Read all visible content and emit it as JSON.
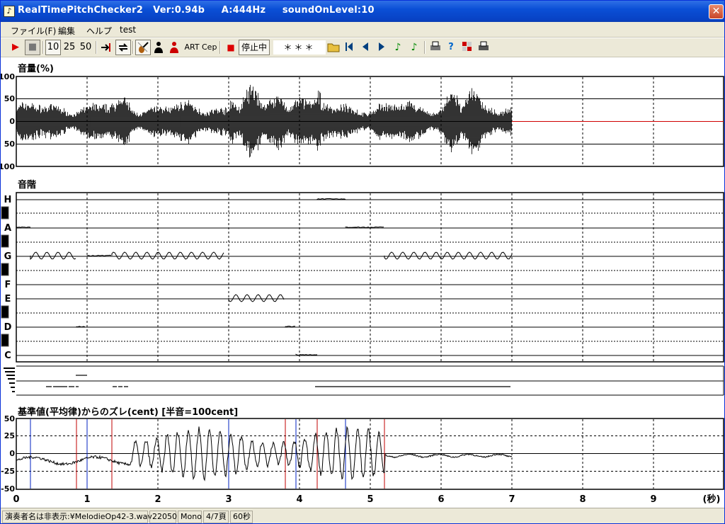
{
  "window": {
    "title": "RealTimePitchChecker2   Ver:0.94b     A:444Hz     soundOnLevel:10",
    "app_icon": "clef-icon",
    "close_glyph": "✕"
  },
  "menu": [
    "ファイル(F)",
    "編集",
    "ヘルプ",
    "test"
  ],
  "toolbar": {
    "play": "▶",
    "stop": "■",
    "speed_10": "10",
    "speed_25": "25",
    "speed_50": "50",
    "art": "ART",
    "cep": "Cep",
    "status_label": "停止中",
    "note_display": "＊＊＊"
  },
  "volume_panel": {
    "title": "音量(%)",
    "y_ticks": [
      "100",
      "50",
      "0",
      "50",
      "100"
    ]
  },
  "scale_panel": {
    "title": "音階",
    "notes": [
      "H",
      "A",
      "G",
      "F",
      "E",
      "D",
      "C"
    ]
  },
  "cent_panel": {
    "title": "基準値(平均律)からのズレ(cent) [半音=100cent]",
    "y_ticks": [
      "50",
      "25",
      "0",
      "-25",
      "-50"
    ]
  },
  "time_axis": {
    "ticks": [
      "0",
      "1",
      "2",
      "3",
      "4",
      "5",
      "6",
      "7",
      "8",
      "9"
    ],
    "unit": "(秒)"
  },
  "chart_data": {
    "type": "line",
    "x_range": [
      0,
      10
    ],
    "x_unit": "seconds",
    "recorded_until": 7,
    "volume": {
      "ylim": [
        -100,
        100
      ]
    },
    "pitch_segments": [
      {
        "note": "A",
        "start": 0.0,
        "end": 0.2
      },
      {
        "note": "G",
        "start": 0.2,
        "end": 0.85
      },
      {
        "note": "D",
        "start": 0.85,
        "end": 0.98
      },
      {
        "note": "G",
        "start": 1.0,
        "end": 1.35
      },
      {
        "note": "G",
        "start": 1.35,
        "end": 2.95
      },
      {
        "note": "E",
        "start": 3.0,
        "end": 3.8
      },
      {
        "note": "D",
        "start": 3.8,
        "end": 3.95
      },
      {
        "note": "C",
        "start": 3.95,
        "end": 4.25
      },
      {
        "note": "H",
        "start": 4.25,
        "end": 4.65
      },
      {
        "note": "A",
        "start": 4.65,
        "end": 5.2
      },
      {
        "note": "G",
        "start": 5.2,
        "end": 7.0
      }
    ],
    "cent": {
      "ylim": [
        -50,
        50
      ]
    }
  },
  "status": {
    "file": "演奏者名は非表示:¥MelodieOp42-3.wav",
    "rate": "22050",
    "channels": "Mono",
    "page": "4/7頁",
    "length": "60秒"
  }
}
